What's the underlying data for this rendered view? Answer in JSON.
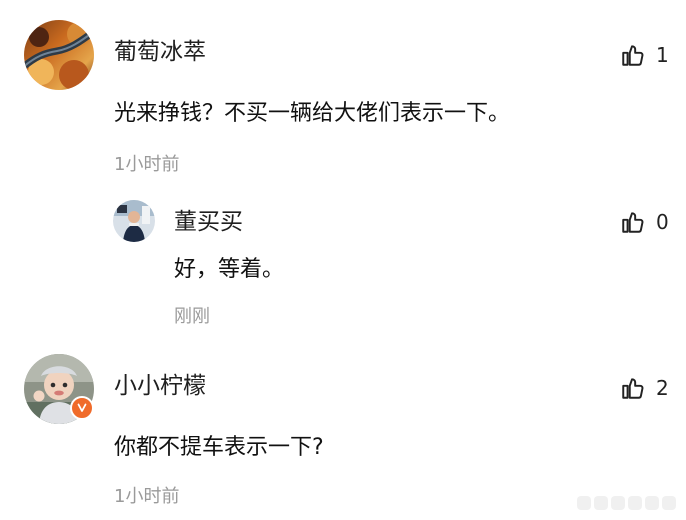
{
  "comments": [
    {
      "author": "葡萄冰萃",
      "text": "光来挣钱？不买一辆给大佬们表示一下。",
      "time": "1小时前",
      "likes": "1"
    },
    {
      "author": "董买买",
      "text": "好，等着。",
      "time": "刚刚",
      "likes": "0"
    },
    {
      "author": "小小柠檬",
      "text": "你都不提车表示一下?",
      "time": "1小时前",
      "likes": "2"
    }
  ],
  "icons": {
    "like": "thumbs-up-icon",
    "verified": "verified-v-icon"
  },
  "colors": {
    "primary_text": "#111111",
    "secondary_text": "#9a9a9a",
    "verified_orange": "#f06b2a"
  }
}
